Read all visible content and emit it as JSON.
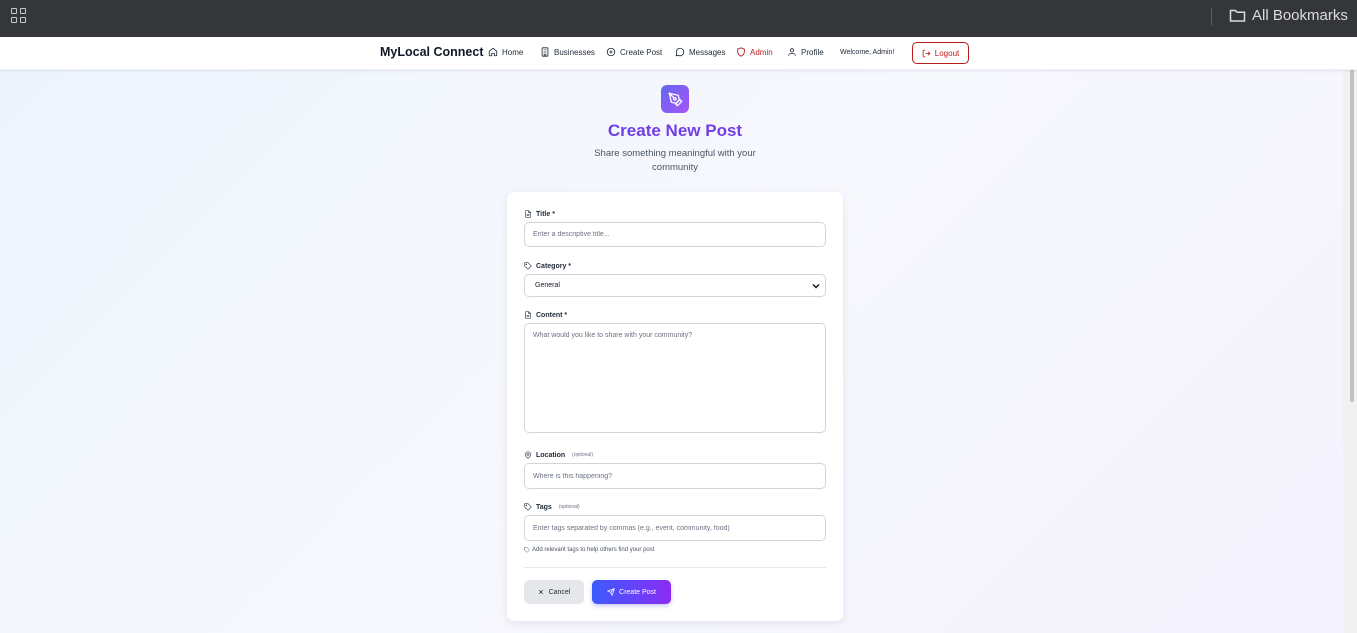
{
  "browser": {
    "bookmarks_label": "All Bookmarks"
  },
  "nav": {
    "brand": "MyLocal Connect",
    "items": [
      {
        "label": "Home",
        "icon": "home-icon"
      },
      {
        "label": "Businesses",
        "icon": "building-icon"
      },
      {
        "label": "Create Post",
        "icon": "plus-circle-icon"
      },
      {
        "label": "Messages",
        "icon": "message-circle-icon"
      },
      {
        "label": "Admin",
        "icon": "shield-icon"
      },
      {
        "label": "Profile",
        "icon": "user-icon"
      }
    ],
    "welcome": "Welcome, Admin!",
    "logout": "Logout"
  },
  "hero": {
    "icon": "pen-tool-icon",
    "title": "Create New Post",
    "subtitle": "Share something meaningful with your community"
  },
  "form": {
    "title": {
      "label": "Title *",
      "placeholder": "Enter a descriptive title..."
    },
    "category": {
      "label": "Category *",
      "value": "General"
    },
    "content": {
      "label": "Content *",
      "placeholder": "What would you like to share with your community?"
    },
    "location": {
      "label": "Location",
      "optional": "(optional)",
      "placeholder": "Where is this happening?"
    },
    "tags": {
      "label": "Tags",
      "optional": "(optional)",
      "placeholder": "Enter tags separated by commas (e.g., event, community, food)",
      "hint": "Add relevant tags to help others find your post"
    },
    "cancel": "Cancel",
    "submit": "Create Post"
  },
  "colors": {
    "admin": "#b91c1c",
    "accent_start": "#3b5bfd",
    "accent_end": "#8b2cf5",
    "title": "#6d28d9"
  }
}
